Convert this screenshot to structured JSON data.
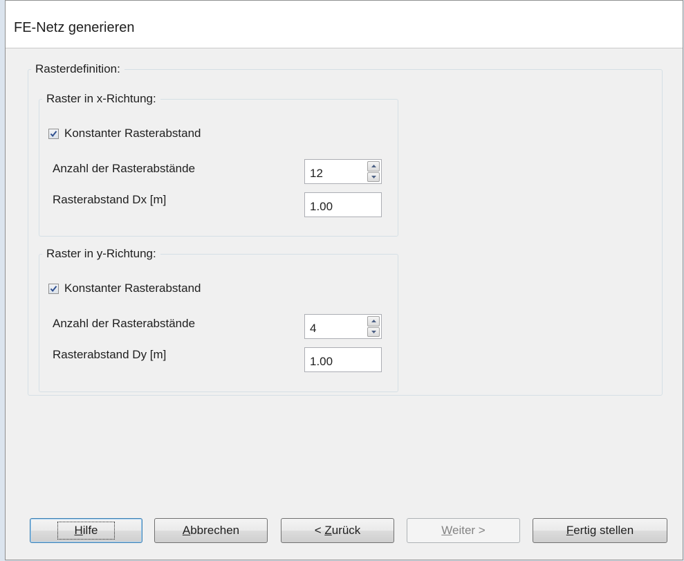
{
  "window": {
    "title": "FE-Netz generieren"
  },
  "group_main": {
    "legend": "Rasterdefinition:"
  },
  "group_x": {
    "legend": "Raster in x-Richtung:",
    "checkbox_label": "Konstanter Rasterabstand",
    "checkbox_checked": true,
    "count_label": "Anzahl der Rasterabstände",
    "count_value": "12",
    "spacing_label": "Rasterabstand  Dx [m]",
    "spacing_value": "1.00"
  },
  "group_y": {
    "legend": "Raster in y-Richtung:",
    "checkbox_label": "Konstanter Rasterabstand",
    "checkbox_checked": true,
    "count_label": "Anzahl der Rasterabstände",
    "count_value": "4",
    "spacing_label": "Rasterabstand  Dy [m]",
    "spacing_value": "1.00"
  },
  "buttons": {
    "help": {
      "mnemonic": "H",
      "rest": "ilfe"
    },
    "cancel": {
      "mnemonic": "A",
      "rest": "bbrechen"
    },
    "back": {
      "pre": "< ",
      "mnemonic": "Z",
      "rest": "urück"
    },
    "next": {
      "mnemonic": "W",
      "rest": "eiter >",
      "enabled": false
    },
    "finish": {
      "mnemonic": "F",
      "rest": "ertig stellen"
    }
  },
  "icons": {
    "checkmark": "check-icon",
    "spin_up": "arrow-up-icon",
    "spin_down": "arrow-down-icon"
  },
  "colors": {
    "check": "#2f4f8f",
    "window_bg": "#f0f0f0"
  }
}
